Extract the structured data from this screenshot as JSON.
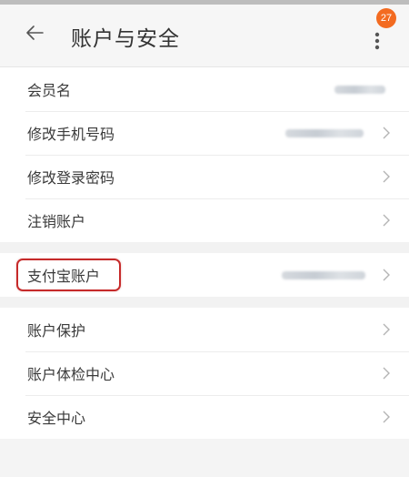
{
  "header": {
    "title": "账户与安全",
    "badge_count": "27",
    "back_icon": "arrow-left-icon",
    "more_icon": "more-vertical-icon"
  },
  "groups": [
    {
      "items": [
        {
          "label": "会员名"
        },
        {
          "label": "修改手机号码"
        },
        {
          "label": "修改登录密码"
        },
        {
          "label": "注销账户"
        }
      ]
    },
    {
      "items": [
        {
          "label": "支付宝账户"
        }
      ]
    },
    {
      "items": [
        {
          "label": "账户保护"
        },
        {
          "label": "账户体检中心"
        },
        {
          "label": "安全中心"
        }
      ]
    }
  ],
  "colors": {
    "accent_badge": "#f36b21",
    "highlight_border": "#c62a2a"
  }
}
